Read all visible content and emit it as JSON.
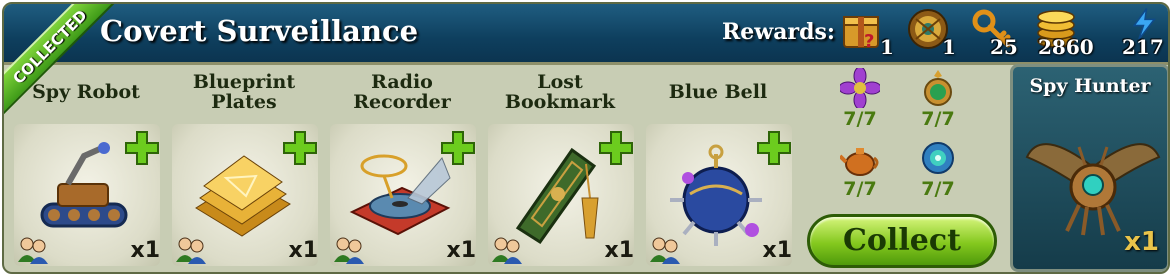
{
  "collection": {
    "title": "Covert Surveillance",
    "status_ribbon": "COLLECTED"
  },
  "rewards": {
    "label": "Rewards:",
    "items": [
      {
        "icon": "mystery-box-icon",
        "count": "1"
      },
      {
        "icon": "amulet-icon",
        "count": "1"
      },
      {
        "icon": "key-icon",
        "count": "25"
      },
      {
        "icon": "coins-icon",
        "count": "2860"
      },
      {
        "icon": "energy-icon",
        "count": "217"
      }
    ]
  },
  "items": [
    {
      "name": "Spy Robot",
      "quantity": "x1"
    },
    {
      "name": "Blueprint Plates",
      "quantity": "x1"
    },
    {
      "name": "Radio Recorder",
      "quantity": "x1"
    },
    {
      "name": "Lost Bookmark",
      "quantity": "x1"
    },
    {
      "name": "Blue Bell",
      "quantity": "x1"
    }
  ],
  "requirements": [
    {
      "icon": "purple-flower-icon",
      "progress": "7/7"
    },
    {
      "icon": "green-pendant-icon",
      "progress": "7/7"
    },
    {
      "icon": "teapot-icon",
      "progress": "7/7"
    },
    {
      "icon": "blue-gem-icon",
      "progress": "7/7"
    }
  ],
  "collect_button": {
    "label": "Collect"
  },
  "final_reward": {
    "name": "Spy Hunter",
    "quantity": "x1"
  },
  "colors": {
    "header": "#0e3f5e",
    "accent_green": "#84c81e",
    "panel": "#c8cdb4"
  }
}
